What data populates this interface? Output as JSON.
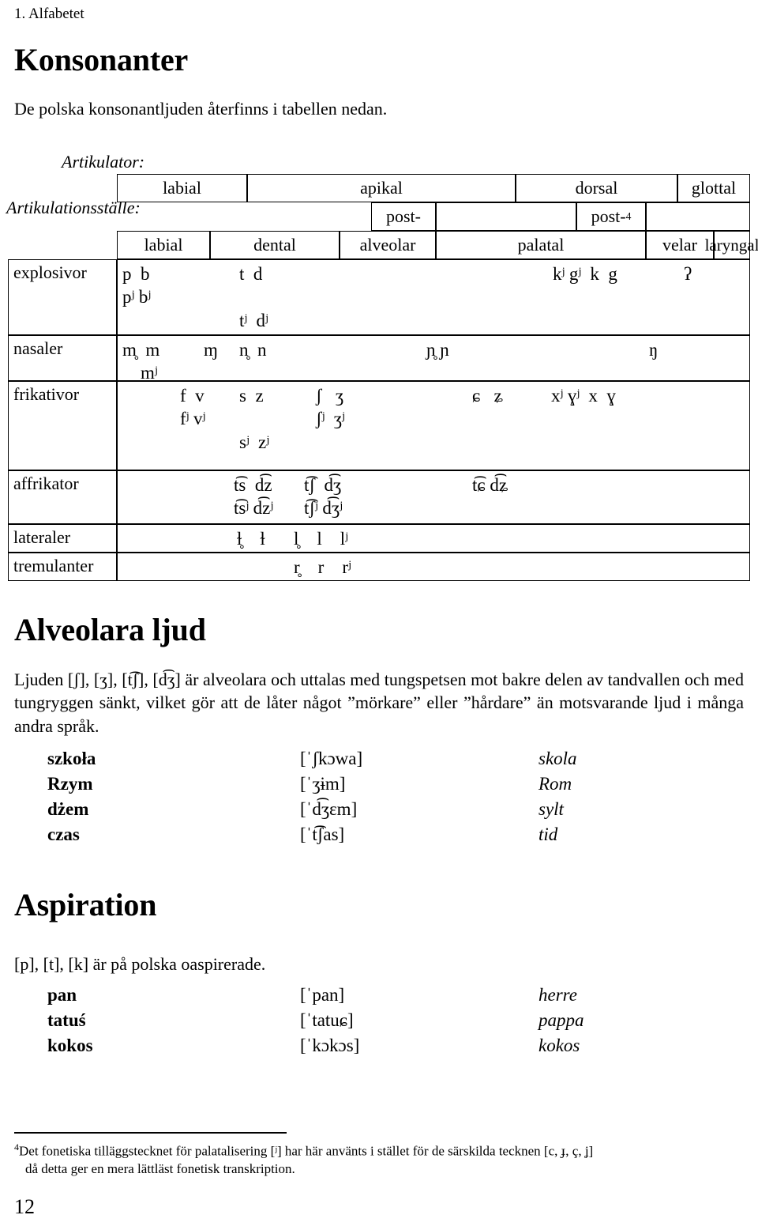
{
  "running_head": "1. Alfabetet",
  "page_number": "12",
  "sections": {
    "konsonanter": {
      "heading": "Konsonanter",
      "intro": "De polska konsonantljuden återfinns i tabellen nedan."
    },
    "alveolara": {
      "heading": "Alveolara ljud",
      "paragraph": "Ljuden [ʃ], [ʒ], [t͡ʃ], [d͡ʒ] är alveolara och uttalas med tungspetsen mot bakre delen av tandvallen och med tungryggen sänkt, vilket gör att de låter något ”mörkare” eller ”hårdare” än motsvarande ljud i många andra språk.",
      "examples": [
        {
          "word": "szkoła",
          "ipa": "[ˈʃkɔwa]",
          "translation": "skola"
        },
        {
          "word": "Rzym",
          "ipa": "[ˈʒɨm]",
          "translation": "Rom"
        },
        {
          "word": "dżem",
          "ipa": "[ˈd͡ʒɛm]",
          "translation": "sylt"
        },
        {
          "word": "czas",
          "ipa": "[ˈt͡ʃas]",
          "translation": "tid"
        }
      ]
    },
    "aspiration": {
      "heading": "Aspiration",
      "paragraph": "[p], [t], [k] är på polska oaspirerade.",
      "examples": [
        {
          "word": "pan",
          "ipa": "[ˈpan]",
          "translation": "herre"
        },
        {
          "word": "tatuś",
          "ipa": "[ˈtatuɕ]",
          "translation": "pappa"
        },
        {
          "word": "kokos",
          "ipa": "[ˈkɔkɔs]",
          "translation": "kokos"
        }
      ]
    }
  },
  "table": {
    "label_articulator": "Artikulator:",
    "label_place": "Artikulationsställe:",
    "articulators": [
      "labial",
      "apikal",
      "dorsal",
      "glottal"
    ],
    "places_upper": [
      "post-",
      "post-"
    ],
    "places": [
      "labial",
      "dental",
      "alveolar",
      "palatal",
      "velar",
      "laryngal"
    ],
    "footnote_marker": "4",
    "rows": [
      {
        "label": "explosivor",
        "cells": {
          "labial": "p  b\npʲ bʲ",
          "dental": "",
          "alveolar": "t  d\n\ntʲ  dʲ",
          "palatal": "",
          "velar": "kʲ gʲ  k  g",
          "laryngal": "ʔ"
        }
      },
      {
        "label": "nasaler",
        "cells": {
          "labial": "m̥  m\n    mʲ",
          "dental": "ɱ",
          "alveolar": "n̥  n",
          "palatal": "ɲ̥ ɲ",
          "velar": "ŋ",
          "laryngal": ""
        }
      },
      {
        "label": "frikativor",
        "cells": {
          "labial": "",
          "dental": "f  v\nfʲ vʲ",
          "alveolar": "s  z\n\nsʲ  zʲ",
          "postalveolar": "ʃ   ʒ\nʃʲ  ʒʲ",
          "palatal": "ɕ   ʑ",
          "velar": "xʲ ɣʲ  x  ɣ",
          "laryngal": ""
        }
      },
      {
        "label": "affrikator",
        "cells": {
          "dental": "t͡s  d͡z\nt͡sʲ d͡zʲ",
          "alveolar": "t͡ʃ  d͡ʒ\nt͡ʃʲ d͡ʒʲ",
          "palatal": "t͡ɕ d͡ʑ"
        }
      },
      {
        "label": "lateraler",
        "cells": {
          "dental": "ɫ̥    ɫ",
          "alveolar": "l̥    l    lʲ"
        }
      },
      {
        "label": "tremulanter",
        "cells": {
          "alveolar": "r̥    r    rʲ"
        }
      }
    ]
  },
  "footnote": {
    "marker": "4",
    "line1": "Det fonetiska tilläggstecknet för palatalisering [ʲ] har här använts i stället för de särskilda tecknen [c, ɟ, ç, ʝ]",
    "line2": "då detta ger en mera lättläst fonetisk transkription."
  }
}
